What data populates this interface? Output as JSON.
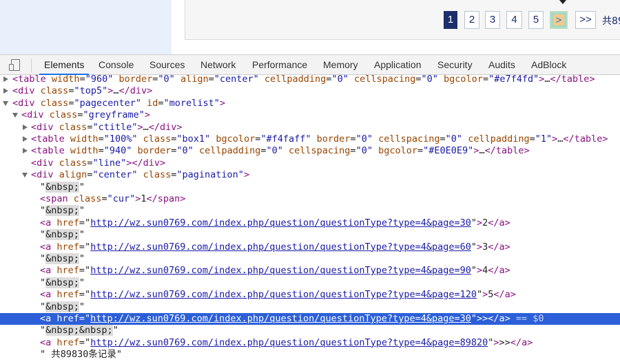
{
  "preview": {
    "pagination": {
      "pages": [
        "1",
        "2",
        "3",
        "4",
        "5"
      ],
      "next_label": ">",
      "last_label": ">>",
      "total_label": "共89"
    }
  },
  "devtools": {
    "tabs": [
      "Elements",
      "Console",
      "Sources",
      "Network",
      "Performance",
      "Memory",
      "Application",
      "Security",
      "Audits",
      "AdBlock"
    ],
    "active_tab": "Elements",
    "tree": {
      "l1": {
        "tag": "table",
        "a1n": "width",
        "a1v": "\"960\"",
        "a2n": "border",
        "a2v": "\"0\"",
        "a3n": "align",
        "a3v": "\"center\"",
        "a4n": "cellpadding",
        "a4v": "\"0\"",
        "a5n": "cellspacing",
        "a5v": "\"0\"",
        "a6n": "bgcolor",
        "a6v": "\"#e7f4fd\""
      },
      "l2": {
        "tag": "div",
        "a1n": "class",
        "a1v": "\"top5\""
      },
      "l3": {
        "tag": "div",
        "a1n": "class",
        "a1v": "\"pagecenter\"",
        "a2n": "id",
        "a2v": "\"morelist\""
      },
      "l4": {
        "tag": "div",
        "a1n": "class",
        "a1v": "\"greyframe\""
      },
      "l5": {
        "tag": "div",
        "a1n": "class",
        "a1v": "\"ctitle\""
      },
      "l6": {
        "tag": "table",
        "a1n": "width",
        "a1v": "\"100%\"",
        "a2n": "class",
        "a2v": "\"box1\"",
        "a3n": "bgcolor",
        "a3v": "\"#f4faff\"",
        "a4n": "border",
        "a4v": "\"0\"",
        "a5n": "cellspacing",
        "a5v": "\"0\"",
        "a6n": "cellpadding",
        "a6v": "\"1\""
      },
      "l7": {
        "tag": "table",
        "a1n": "width",
        "a1v": "\"940\"",
        "a2n": "border",
        "a2v": "\"0\"",
        "a3n": "cellpadding",
        "a3v": "\"0\"",
        "a4n": "cellspacing",
        "a4v": "\"0\"",
        "a5n": "bgcolor",
        "a5v": "\"#E0E0E9\""
      },
      "l8": {
        "tag": "div",
        "a1n": "class",
        "a1v": "\"line\""
      },
      "l9": {
        "tag": "div",
        "a1n": "align",
        "a1v": "\"center\"",
        "a2n": "class",
        "a2v": "\"pagination\""
      },
      "nbsp": "&nbsp;",
      "l11": {
        "tag": "span",
        "a1n": "class",
        "a1v": "\"cur\"",
        "text": "1"
      },
      "href_name": "href",
      "links": [
        {
          "href": "http://wz.sun0769.com/index.php/question/questionType?type=4&page=30",
          "text": "2"
        },
        {
          "href": "http://wz.sun0769.com/index.php/question/questionType?type=4&page=60",
          "text": "3"
        },
        {
          "href": "http://wz.sun0769.com/index.php/question/questionType?type=4&page=90",
          "text": "4"
        },
        {
          "href": "http://wz.sun0769.com/index.php/question/questionType?type=4&page=120",
          "text": "5"
        },
        {
          "href": "http://wz.sun0769.com/index.php/question/questionType?type=4&page=30",
          "text": ">"
        },
        {
          "href": "http://wz.sun0769.com/index.php/question/questionType?type=4&page=89820",
          "text": ">>"
        }
      ],
      "selected_suffix": "== $0",
      "nbsp2": "&nbsp;&nbsp;",
      "total_text": "\" 共89830条记录\""
    }
  }
}
